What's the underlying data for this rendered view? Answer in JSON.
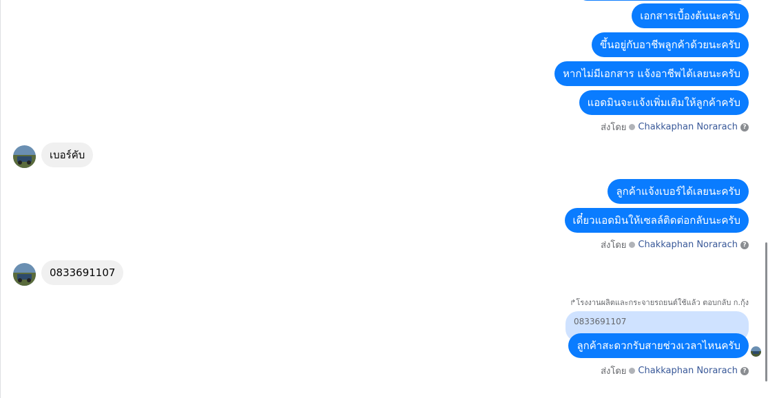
{
  "messages_block_1": {
    "outgoing": [
      "เอกสารเบื้องต้นนะครับ",
      "ขึ้นอยู่กับอาชีพลูกค้าด้วยนะครับ",
      "หากไม่มีเอกสาร แจ้งอาชีพได้เลยนะครับ",
      "แอดมินจะแจ้งเพิ่มเติมให้ลูกค้าครับ"
    ],
    "sent_by_label": "ส่งโดย",
    "sender_name": "Chakkaphan Norarach"
  },
  "incoming_1": "เบอร์คับ",
  "messages_block_2": {
    "outgoing": [
      "ลูกค้าแจ้งเบอร์ได้เลยนะครับ",
      "เดี๋ยวแอดมินให้เซลล์ติดต่อกลับนะครับ"
    ],
    "sent_by_label": "ส่งโดย",
    "sender_name": "Chakkaphan Norarach"
  },
  "incoming_2": "0833691107",
  "reply_block": {
    "caption": "โรงงานผลิตและกระจายรถยนต์ใช้แล้ว ตอบกลับ ก.กุ้ง",
    "quoted_text": "0833691107",
    "message": "ลูกค้าสะดวกรับสายช่วงเวลาไหนครับ",
    "sent_by_label": "ส่งโดย",
    "sender_name": "Chakkaphan Norarach"
  },
  "icons": {
    "help": "?",
    "reply": "↱"
  },
  "colors": {
    "outgoing_bubble": "#0a7cff",
    "incoming_bubble": "#f0f0f0",
    "quote_bubble": "#cfe2ff",
    "sender_link": "#385898"
  }
}
